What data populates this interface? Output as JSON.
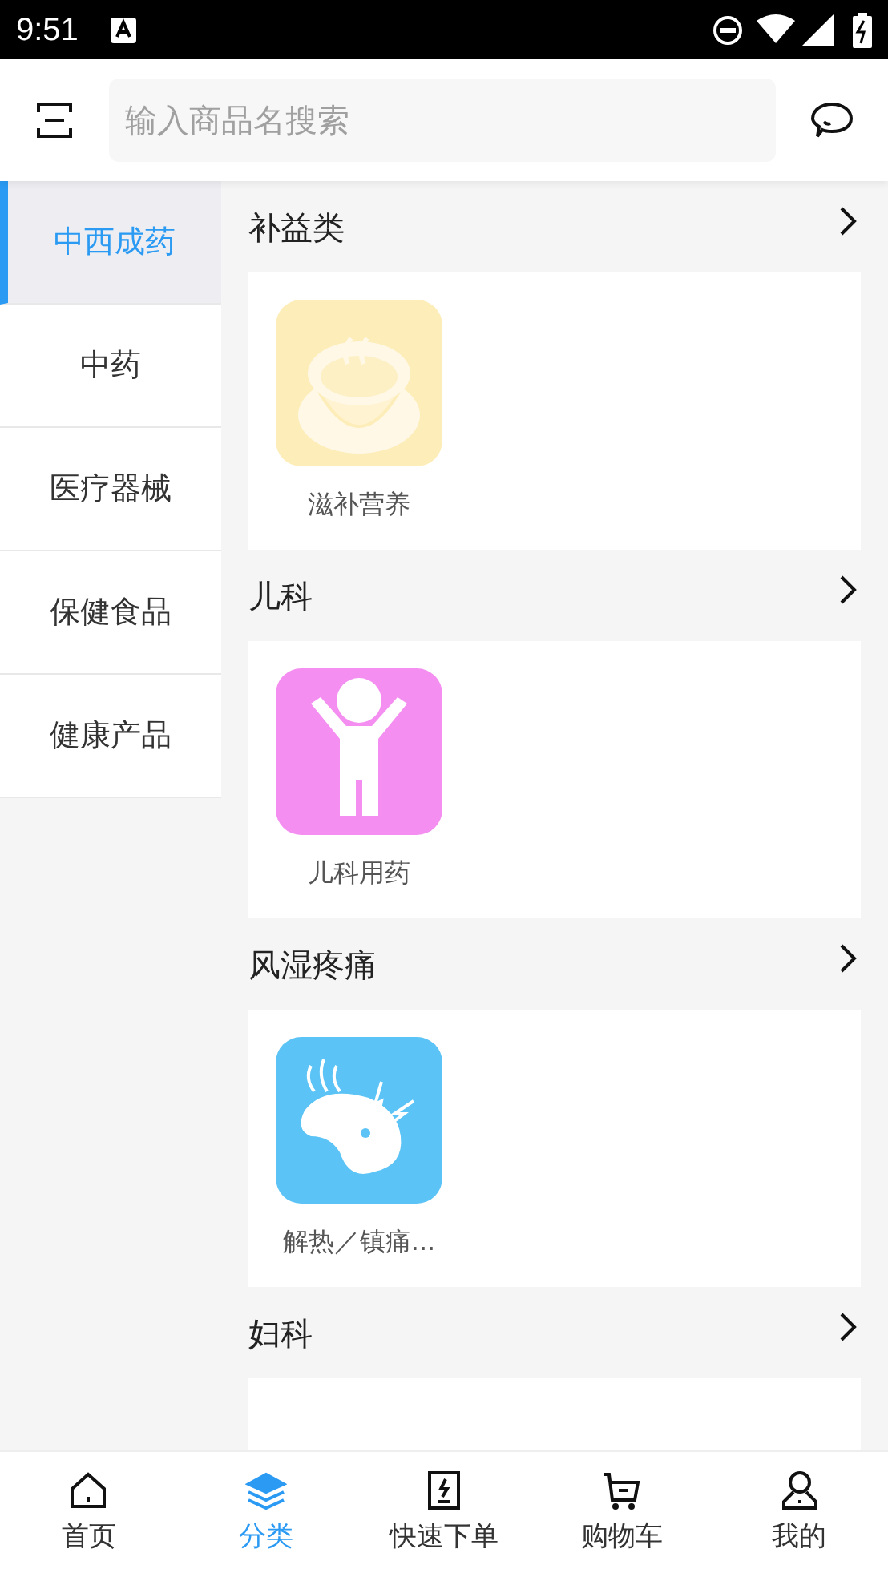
{
  "status_bar": {
    "time": "9:51"
  },
  "search": {
    "placeholder": "输入商品名搜索"
  },
  "sidebar": {
    "items": [
      {
        "label": "中西成药",
        "selected": true
      },
      {
        "label": "中药",
        "selected": false
      },
      {
        "label": "医疗器械",
        "selected": false
      },
      {
        "label": "保健食品",
        "selected": false
      },
      {
        "label": "健康产品",
        "selected": false
      }
    ]
  },
  "sections": [
    {
      "title": "补益类",
      "items": [
        {
          "label": "滋补营养",
          "kind": "tonic"
        }
      ]
    },
    {
      "title": "儿科",
      "items": [
        {
          "label": "儿科用药",
          "kind": "pediatric"
        }
      ]
    },
    {
      "title": "风湿疼痛",
      "items": [
        {
          "label": "解热／镇痛...",
          "kind": "pain"
        }
      ]
    },
    {
      "title": "妇科"
    }
  ],
  "tab_bar": [
    {
      "label": "首页",
      "kind": "home",
      "selected": false
    },
    {
      "label": "分类",
      "kind": "category",
      "selected": true
    },
    {
      "label": "快速下单",
      "kind": "quick",
      "selected": false
    },
    {
      "label": "购物车",
      "kind": "cart",
      "selected": false
    },
    {
      "label": "我的",
      "kind": "me",
      "selected": false
    }
  ]
}
